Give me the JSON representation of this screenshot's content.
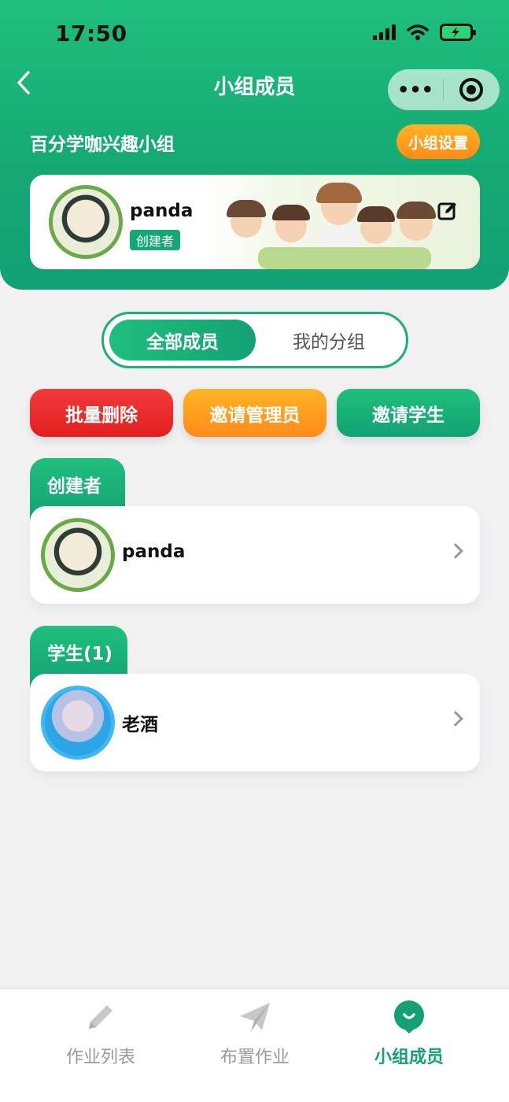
{
  "status_bar": {
    "time": "17:50"
  },
  "nav": {
    "title": "小组成员",
    "more_label": "•••"
  },
  "group": {
    "name": "百分学咖兴趣小组",
    "settings_label": "小组设置"
  },
  "owner": {
    "name": "panda",
    "role": "创建者"
  },
  "segments": {
    "active": "全部成员",
    "inactive": "我的分组"
  },
  "actions": {
    "batch_delete": "批量删除",
    "invite_admin": "邀请管理员",
    "invite_student": "邀请学生"
  },
  "sections": [
    {
      "title": "创建者",
      "members": [
        {
          "name": "panda",
          "avatar": "panda-avatar"
        }
      ]
    },
    {
      "title": "学生(1)",
      "members": [
        {
          "name": "老酒",
          "avatar": "girl-avatar"
        }
      ]
    }
  ],
  "tabbar": {
    "items": [
      {
        "label": "作业列表",
        "icon": "pencil-icon",
        "active": false
      },
      {
        "label": "布置作业",
        "icon": "paper-plane-icon",
        "active": false
      },
      {
        "label": "小组成员",
        "icon": "group-icon",
        "active": true
      }
    ]
  },
  "colors": {
    "primary": "#13a174",
    "orange": "#ff8b1a",
    "red": "#e0201f",
    "background": "#f1f1f2"
  }
}
